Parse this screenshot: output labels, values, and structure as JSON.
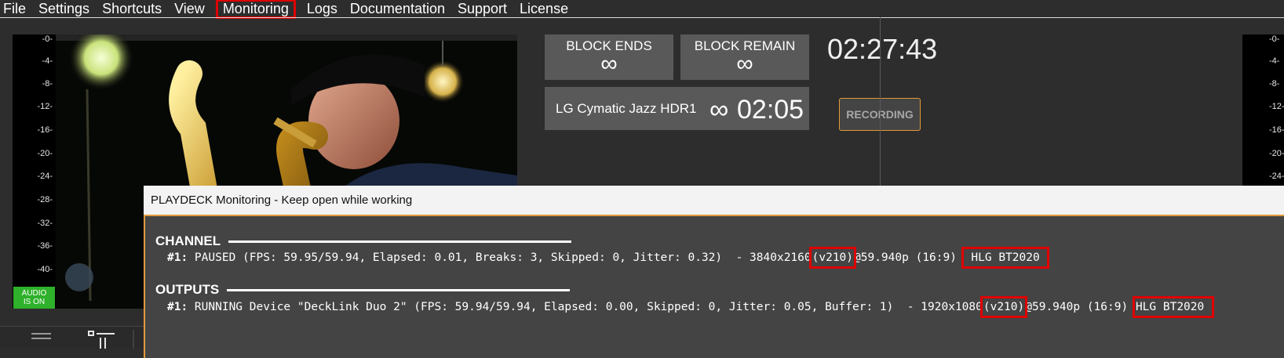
{
  "menu": [
    "File",
    "Settings",
    "Shortcuts",
    "View",
    "Monitoring",
    "Logs",
    "Documentation",
    "Support",
    "License"
  ],
  "meter_ticks": [
    "-0-",
    "-4-",
    "-8-",
    "-12-",
    "-16-",
    "-20-",
    "-24-",
    "-28-",
    "-32-",
    "-36-",
    "-40-"
  ],
  "audio_badge": [
    "AUDIO",
    "IS ON"
  ],
  "blocks": {
    "ends_label": "BLOCK ENDS",
    "ends_value": "∞",
    "remain_label": "BLOCK REMAIN",
    "remain_value": "∞"
  },
  "clock": "02:27:43",
  "now_playing": {
    "title": "LG Cymatic Jazz HDR1",
    "infinity": "∞",
    "time": "02:05"
  },
  "record_button": "RECORDING",
  "monitor_window": {
    "title": "PLAYDECK Monitoring - Keep open while working",
    "channel_heading": "CHANNEL",
    "channel_index": "#1:",
    "channel_text_a": " PAUSED (FPS: 59.95/59.94, Elapsed: 0.01, Breaks: 3, Skipped: 0, Jitter: 0.32)  - 3840x216",
    "channel_tail_digit": "0",
    "channel_format": "(v210)",
    "channel_text_b": "@59.940p (16:9) ",
    "channel_hdr": " HLG BT2020 ",
    "outputs_heading": "OUTPUTS",
    "output_index": "#1:",
    "output_text_a": " RUNNING Device \"DeckLink Duo 2\" (FPS: 59.94/59.94, Elapsed: 0.00, Skipped: 0, Jitter: 0.05, Buffer: 1)  - 1920x108",
    "output_tail_digit": "0",
    "output_format": "(v210)",
    "output_text_b": "@59.940p (16:9) ",
    "output_hdr": "HLG BT2020 "
  },
  "colors": {
    "highlight": "#e00000",
    "accent_orange": "#e39a3a",
    "audio_green": "#2fb12b"
  }
}
